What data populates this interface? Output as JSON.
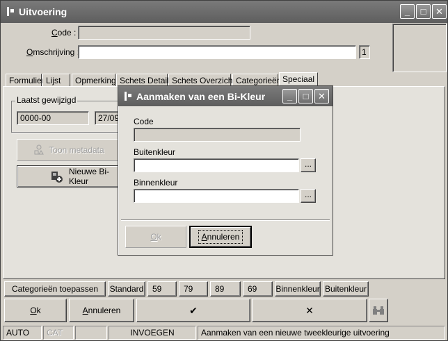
{
  "window": {
    "title": "Uitvoering",
    "controls": {
      "minimize": "_",
      "maximize": "□",
      "close": "✕"
    }
  },
  "header": {
    "code_label": "Code :",
    "code_value": "",
    "omschrijving_label": "Omschrijving :",
    "omschrijving_value": "",
    "counter": "1"
  },
  "tabs": [
    "Formulier",
    "Lijst",
    "Opmerking",
    "Schets Detail",
    "Schets Overzicht",
    "Categorieën",
    "Speciaal"
  ],
  "panel": {
    "group_title": "Laatst gewijzigd",
    "field1": "0000-00",
    "field2": "27/09",
    "toon_metadata": "Toon metadata",
    "nieuwe_bikleur": "Nieuwe Bi-Kleur"
  },
  "dialog": {
    "title": "Aanmaken van een Bi-Kleur",
    "controls": {
      "minimize": "_",
      "maximize": "□",
      "close": "✕"
    },
    "code_label": "Code",
    "code_value": "",
    "buitenkleur_label": "Buitenkleur",
    "buitenkleur_value": "",
    "binnenkleur_label": "Binnenkleur",
    "binnenkleur_value": "",
    "browse": "...",
    "ok": "Ok",
    "annuleren": "Annuleren"
  },
  "filter_bar": [
    "Categorieën toepassen",
    "Standard",
    "59",
    "79",
    "89",
    "69",
    "Binnenkleur",
    "Buitenkleur"
  ],
  "actions": {
    "ok": "Ok",
    "annuleren": "Annuleren",
    "check": "✔",
    "cross": "✕",
    "binoculars": "binoculars"
  },
  "status": {
    "mode": "AUTO",
    "cat": "CAT",
    "empty": "",
    "insert": "INVOEGEN",
    "message": "Aanmaken van een nieuwe tweekleurige uitvoering"
  },
  "colors": {
    "titlebar": "#6a6a6a",
    "face": "#d4d0c8",
    "field": "#ffffff"
  }
}
